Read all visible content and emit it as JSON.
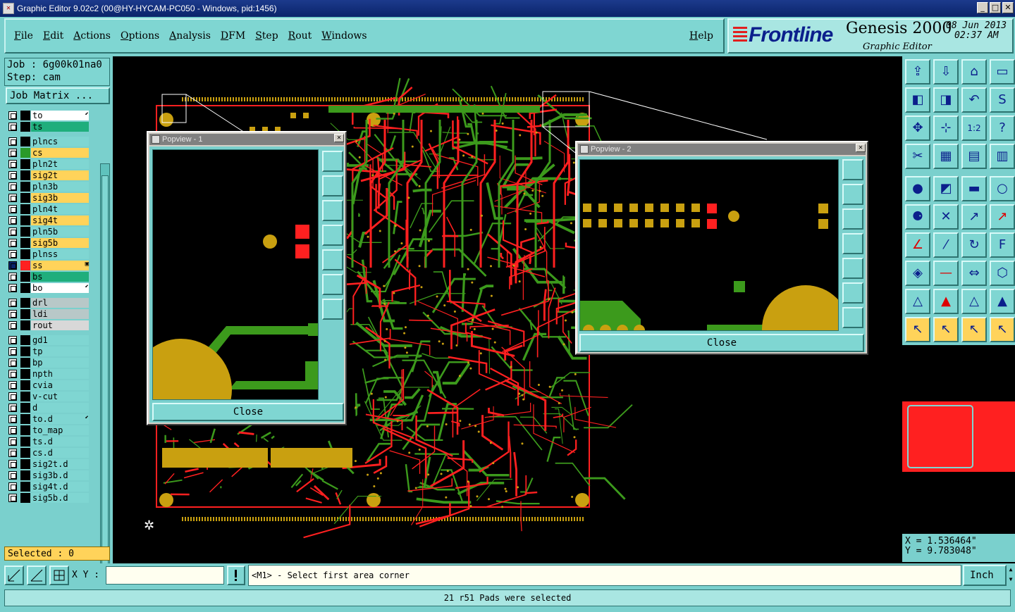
{
  "window": {
    "title": "Graphic Editor 9.02c2 (00@HY-HYCAM-PC050 - Windows, pid:1456)",
    "minimize": "_",
    "maximize": "□",
    "close": "✕"
  },
  "menu": [
    "File",
    "Edit",
    "Actions",
    "Options",
    "Analysis",
    "DFM",
    "Step",
    "Rout",
    "Windows"
  ],
  "help_label": "Help",
  "brand": {
    "logo": "Frontline",
    "product": "Genesis 2000",
    "subtitle": "Graphic Editor",
    "date": "08 Jun 2013",
    "time": "02:37 AM"
  },
  "job": {
    "job_label": "Job : 6g00k01na0",
    "step_label": "Step: cam",
    "matrix_button": "Job Matrix ..."
  },
  "layers": [
    {
      "name": "to",
      "color": "#ffffff",
      "swatch": "#000000",
      "tag": "⬋"
    },
    {
      "name": "ts",
      "color": "#1fae7c",
      "swatch": "#000000",
      "tag": ""
    },
    {
      "name": "plncs",
      "color": "#7fd6d2",
      "swatch": "#000000",
      "tag": ""
    },
    {
      "name": "cs",
      "color": "#ffd35a",
      "swatch": "#2a9a2a",
      "tag": ""
    },
    {
      "name": "pln2t",
      "color": "#7fd6d2",
      "swatch": "#000000",
      "tag": ""
    },
    {
      "name": "sig2t",
      "color": "#ffd35a",
      "swatch": "#000000",
      "tag": ""
    },
    {
      "name": "pln3b",
      "color": "#7fd6d2",
      "swatch": "#000000",
      "tag": ""
    },
    {
      "name": "sig3b",
      "color": "#ffd35a",
      "swatch": "#000000",
      "tag": ""
    },
    {
      "name": "pln4t",
      "color": "#7fd6d2",
      "swatch": "#000000",
      "tag": ""
    },
    {
      "name": "sig4t",
      "color": "#ffd35a",
      "swatch": "#000000",
      "tag": ""
    },
    {
      "name": "pln5b",
      "color": "#7fd6d2",
      "swatch": "#000000",
      "tag": ""
    },
    {
      "name": "sig5b",
      "color": "#ffd35a",
      "swatch": "#000000",
      "tag": ""
    },
    {
      "name": "plnss",
      "color": "#7fd6d2",
      "swatch": "#000000",
      "tag": ""
    },
    {
      "name": "ss",
      "color": "#ffd35a",
      "swatch": "#ff2020",
      "tag": "▣"
    },
    {
      "name": "bs",
      "color": "#1fae7c",
      "swatch": "#000000",
      "tag": ""
    },
    {
      "name": "bo",
      "color": "#ffffff",
      "swatch": "#000000",
      "tag": "⬋"
    },
    {
      "name": "drl",
      "color": "#b8c8c8",
      "swatch": "#000000",
      "tag": ""
    },
    {
      "name": "ldi",
      "color": "#b8c8c8",
      "swatch": "#000000",
      "tag": ""
    },
    {
      "name": "rout",
      "color": "#d8d8d8",
      "swatch": "#000000",
      "tag": ""
    },
    {
      "name": "gd1",
      "color": "#7fd6d2",
      "swatch": "#000000",
      "tag": ""
    },
    {
      "name": "tp",
      "color": "#7fd6d2",
      "swatch": "#000000",
      "tag": ""
    },
    {
      "name": "bp",
      "color": "#7fd6d2",
      "swatch": "#000000",
      "tag": ""
    },
    {
      "name": "npth",
      "color": "#7fd6d2",
      "swatch": "#000000",
      "tag": ""
    },
    {
      "name": "cvia",
      "color": "#7fd6d2",
      "swatch": "#000000",
      "tag": ""
    },
    {
      "name": "v-cut",
      "color": "#7fd6d2",
      "swatch": "#000000",
      "tag": ""
    },
    {
      "name": "d",
      "color": "#7fd6d2",
      "swatch": "#000000",
      "tag": ""
    },
    {
      "name": "to.d",
      "color": "#7fd6d2",
      "swatch": "#000000",
      "tag": "⬋"
    },
    {
      "name": "to_map",
      "color": "#7fd6d2",
      "swatch": "#000000",
      "tag": ""
    },
    {
      "name": "ts.d",
      "color": "#7fd6d2",
      "swatch": "#000000",
      "tag": ""
    },
    {
      "name": "cs.d",
      "color": "#7fd6d2",
      "swatch": "#000000",
      "tag": ""
    },
    {
      "name": "sig2t.d",
      "color": "#7fd6d2",
      "swatch": "#000000",
      "tag": ""
    },
    {
      "name": "sig3b.d",
      "color": "#7fd6d2",
      "swatch": "#000000",
      "tag": ""
    },
    {
      "name": "sig4t.d",
      "color": "#7fd6d2",
      "swatch": "#000000",
      "tag": ""
    },
    {
      "name": "sig5b.d",
      "color": "#7fd6d2",
      "swatch": "#000000",
      "tag": ""
    }
  ],
  "selected_label": "Selected : 0",
  "popview1": {
    "title": "Popview - 1",
    "close_label": "Close"
  },
  "popview2": {
    "title": "Popview - 2",
    "close_label": "Close"
  },
  "coords": {
    "x": "X = 1.536464\"",
    "y": "Y = 9.783048\""
  },
  "command": {
    "xy_label": "X Y :",
    "xy_value": "",
    "prompt": "<M1> - Select first area corner",
    "units": "Inch"
  },
  "status": "21 r51 Pads were selected",
  "colors": {
    "panel": "#7ad0cd",
    "copper_gold": "#c9a010",
    "trace_green": "#3c9a1c",
    "trace_red": "#ff2020",
    "highlight": "#ffd35a"
  }
}
